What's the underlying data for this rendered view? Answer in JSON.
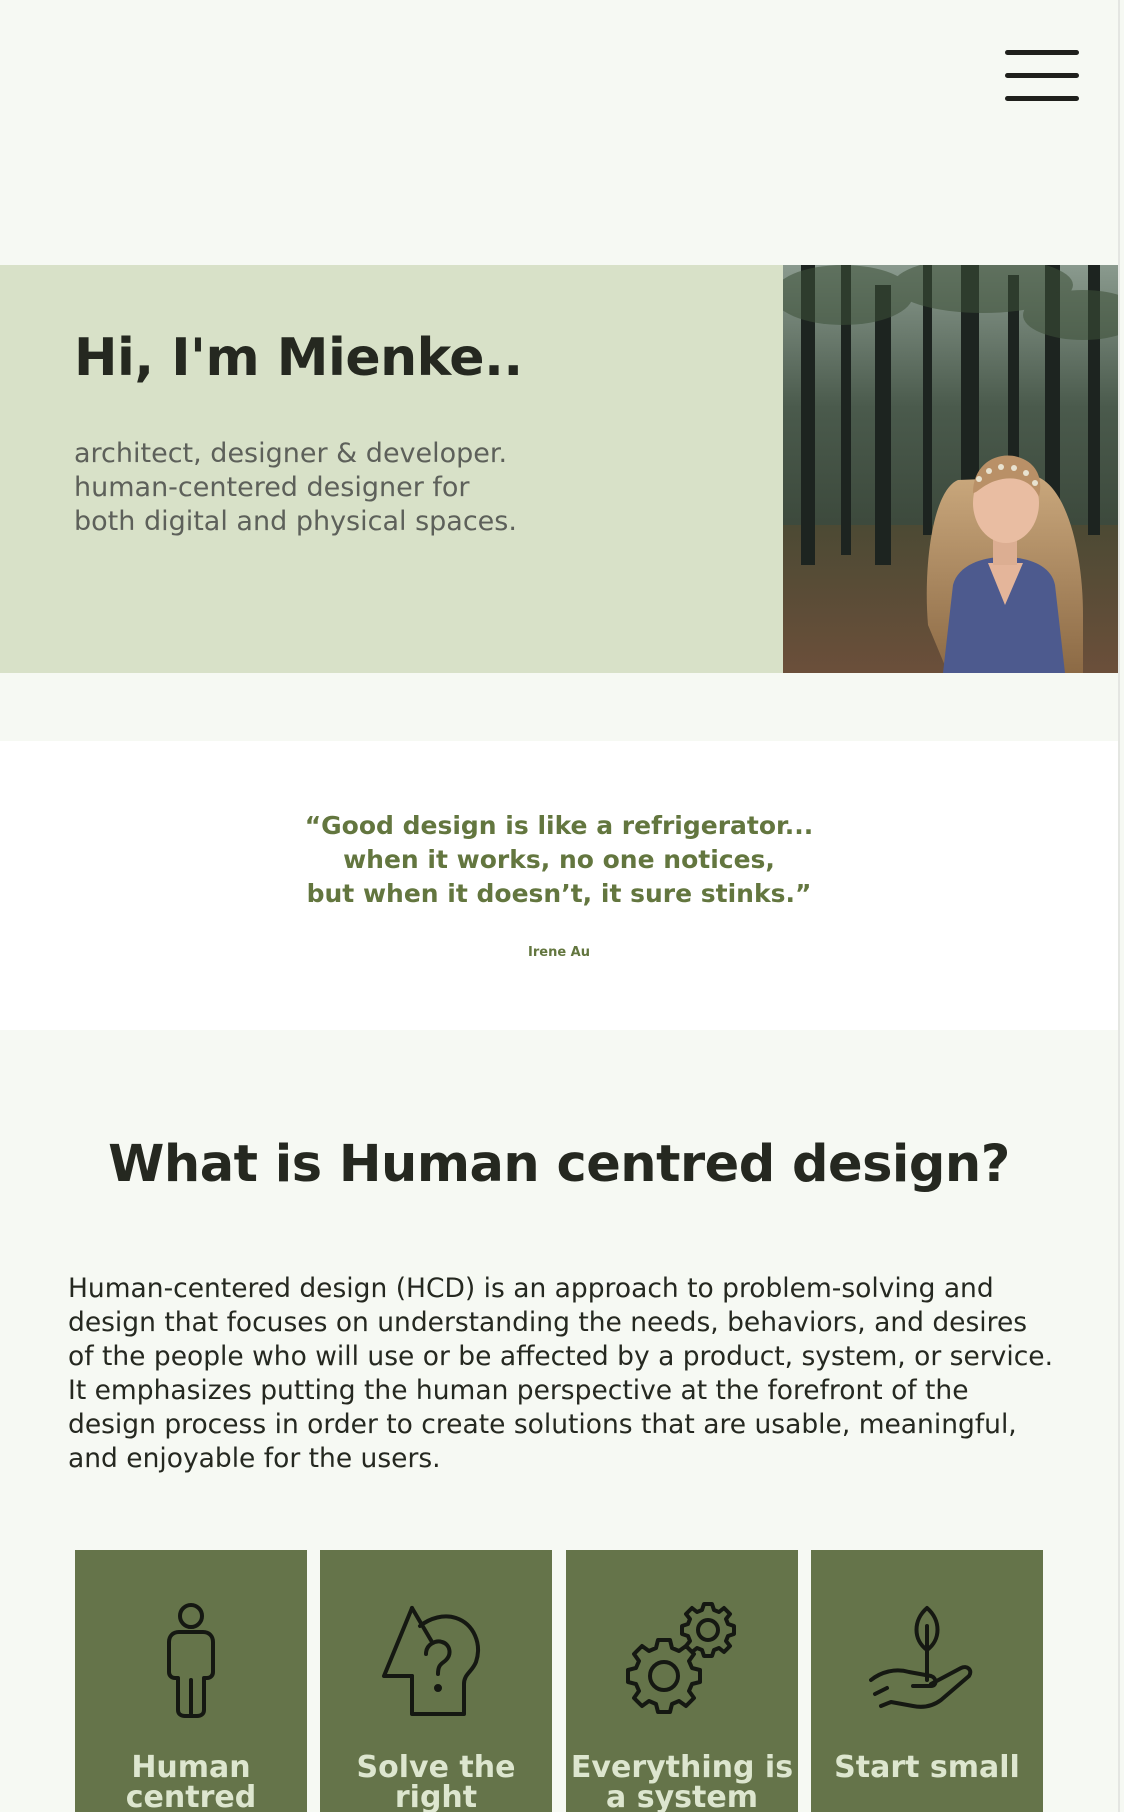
{
  "header": {
    "menu_icon": "hamburger-menu-icon"
  },
  "hero": {
    "title": "Hi, I'm Mienke..",
    "subtitle_lines": [
      "architect, designer & developer.",
      "human-centered designer for",
      "both digital and physical spaces."
    ],
    "photo": "portrait-photo"
  },
  "quote": {
    "lines": [
      "“Good design is like a refrigerator...",
      "when it works, no one notices,",
      "but when it doesn’t, it sure stinks.”"
    ],
    "author": "Irene Au"
  },
  "hcd": {
    "title": "What is Human centred design?",
    "body_lines": [
      "Human-centered design (HCD) is an approach to problem-solving and",
      "design that focuses on understanding the needs, behaviors, and desires",
      "of the people who will use or be affected by a product, system, or service.",
      "It emphasizes putting the human perspective at the forefront of the",
      "design process in order to create solutions that are usable, meaningful,",
      "and enjoyable for the users."
    ]
  },
  "cards": [
    {
      "icon": "person-icon",
      "label": "Human centred"
    },
    {
      "icon": "question-head-icon",
      "label": "Solve the right"
    },
    {
      "icon": "gears-icon",
      "label": "Everything is a system"
    },
    {
      "icon": "hand-sprout-icon",
      "label": "Start small"
    }
  ],
  "colors": {
    "background": "#f6f9f3",
    "hero_background": "#d8e1c8",
    "accent_green": "#63763f",
    "card_green": "#65744a",
    "dark_text": "#252820"
  }
}
